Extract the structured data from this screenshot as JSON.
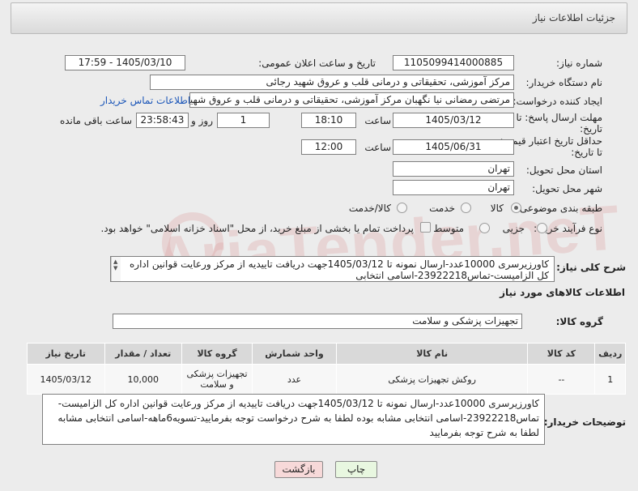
{
  "header": {
    "title": "جزئیات اطلاعات نیاز"
  },
  "fields": {
    "need_number_label": "شماره نیاز:",
    "need_number": "1105099414000885",
    "announce_label": "تاریخ و ساعت اعلان عمومی:",
    "announce_value": "1405/03/10 - 17:59",
    "buyer_org_label": "نام دستگاه خریدار:",
    "buyer_org": "مرکز آموزشی، تحقیقاتی و درمانی قلب و عروق شهید رجائی",
    "creator_label": "ایجاد کننده درخواست:",
    "creator": "مرتضی رمضانی نیا نگهبان مرکز آموزشی، تحقیقاتی و درمانی قلب و عروق شهید رجائی",
    "contact_link": "اطلاعات تماس خریدار",
    "reply_deadline_label_1": "مهلت ارسال پاسخ: تا",
    "reply_deadline_label_2": "تاریخ:",
    "reply_date": "1405/03/12",
    "time_label": "ساعت",
    "reply_time": "18:10",
    "days_count": "1",
    "days_label": "روز و",
    "remaining_time": "23:58:43",
    "remaining_label": "ساعت باقی مانده",
    "price_validity_label_1": "حداقل تاریخ اعتبار قیمت:",
    "price_validity_label_2": "تا تاریخ:",
    "validity_date": "1405/06/31",
    "validity_time": "12:00",
    "province_label": "استان محل تحویل:",
    "province": "تهران",
    "city_label": "شهر محل تحویل:",
    "city": "تهران",
    "category_label": "طبقه بندی موضوعی:",
    "category_options": [
      "کالا",
      "خدمت",
      "کالا/خدمت"
    ],
    "purchase_type_label": "نوع فرآیند خرید :",
    "purchase_options": [
      "جزیی",
      "متوسط"
    ],
    "payment_note": "پرداخت تمام یا بخشی از مبلغ خرید، از محل \"اسناد خزانه اسلامی\" خواهد بود."
  },
  "description": {
    "label": "شرح کلی نیاز:",
    "text": "کاورزیرسری 10000عدد-ارسال نمونه تا 1405/03/12جهت دریافت تاییدیه از مرکز ورعایت قوانین اداره کل الزامیست-تماس23922218-اسامی انتخابی"
  },
  "goods": {
    "section_title": "اطلاعات کالاهای مورد نیاز",
    "group_label": "گروه کالا:",
    "group_value": "تجهیزات پزشکی و سلامت",
    "columns": [
      "ردیف",
      "کد کالا",
      "نام کالا",
      "واحد شمارش",
      "گروه کالا",
      "تعداد / مقدار",
      "تاریخ نیاز"
    ],
    "rows": [
      [
        "1",
        "--",
        "روکش تجهیزات پزشکی",
        "عدد",
        "تجهیزات پزشکی و سلامت",
        "10,000",
        "1405/03/12"
      ]
    ]
  },
  "buyer_notes": {
    "label": "توضیحات خریدار:",
    "text": "کاورزیرسری 10000عدد-ارسال نمونه تا 1405/03/12جهت دریافت تاییدیه از مرکز ورعایت قوانین اداره کل الزامیست-تماس23922218-اسامی انتخابی مشابه بوده لطفا به شرح درخواست توجه بفرمایید-تسویه6ماهه-اسامی انتخابی مشابه لطفا به شرح توجه بفرمایید"
  },
  "buttons": {
    "print": "چاپ",
    "back": "بازگشت"
  },
  "watermark": "AriaTender.neT",
  "colors": {
    "link": "#1a55b8",
    "back_button": "#f7d9d9",
    "print_button": "#e8f7e0"
  }
}
